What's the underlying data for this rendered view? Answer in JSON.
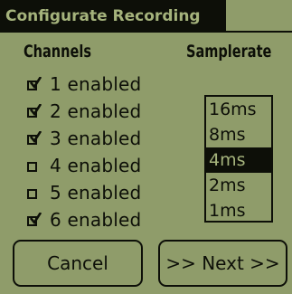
{
  "window": {
    "title": "Configurate Recording"
  },
  "channels": {
    "heading": "Channels",
    "items": [
      {
        "label": "1 enabled",
        "checked": true
      },
      {
        "label": "2 enabled",
        "checked": true
      },
      {
        "label": "3 enabled",
        "checked": true
      },
      {
        "label": "4 enabled",
        "checked": false
      },
      {
        "label": "5 enabled",
        "checked": false
      },
      {
        "label": "6 enabled",
        "checked": true
      }
    ]
  },
  "samplerate": {
    "heading": "Samplerate",
    "options": [
      "16ms",
      "8ms",
      "4ms",
      "2ms",
      "1ms"
    ],
    "selected": "4ms"
  },
  "buttons": {
    "cancel_label": "Cancel",
    "next_label": ">> Next >>"
  },
  "colors": {
    "background": "#8f9c6a",
    "foreground": "#0d0f08",
    "inverse_text": "#a5b37c"
  }
}
